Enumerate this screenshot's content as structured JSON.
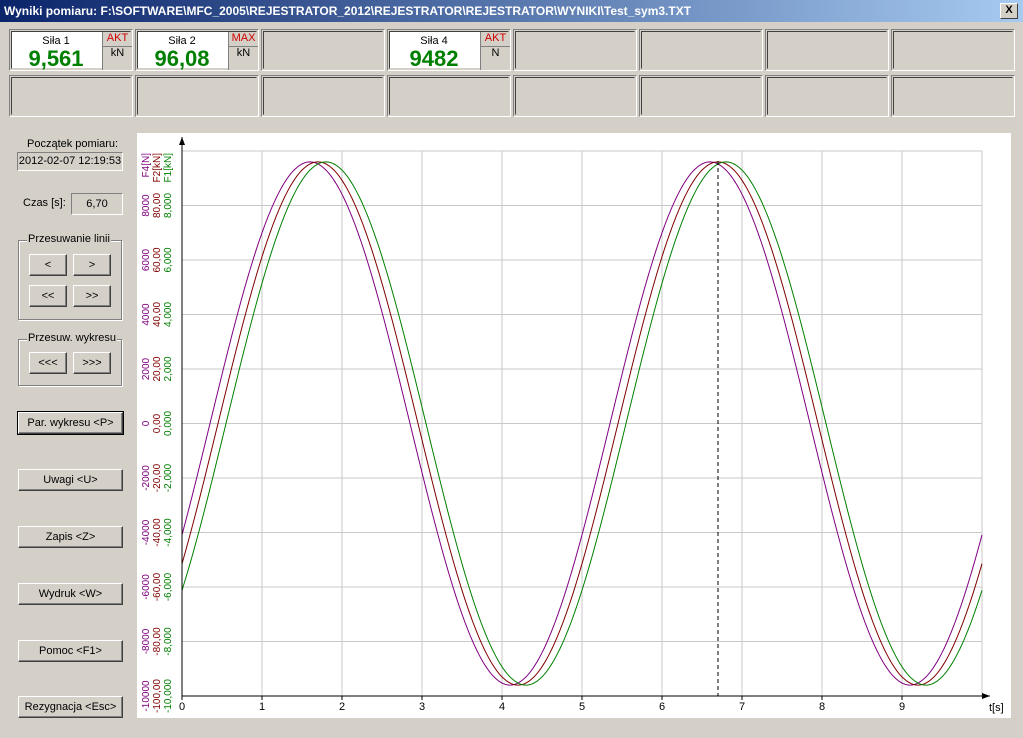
{
  "window": {
    "title": "Wyniki pomiaru: F:\\SOFTWARE\\MFC_2005\\REJESTRATOR_2012\\REJESTRATOR\\REJESTRATOR\\WYNIKI\\Test_sym3.TXT",
    "close": "X"
  },
  "panels": [
    {
      "name": "Siła 1",
      "value": "9,561",
      "mode": "AKT",
      "unit": "kN"
    },
    {
      "name": "Siła 2",
      "value": "96,08",
      "mode": "MAX",
      "unit": "kN"
    },
    {
      "name": "Siła 4",
      "value": "9482",
      "mode": "AKT",
      "unit": "N"
    }
  ],
  "left": {
    "start_label": "Początek pomiaru:",
    "start_value": "2012-02-07 12:19:53",
    "time_label": "Czas [s]:",
    "time_value": "6,70",
    "line_shift": {
      "title": "Przesuwanie linii",
      "b1": "<",
      "b2": ">",
      "b3": "<<",
      "b4": ">>"
    },
    "chart_shift": {
      "title": "Przesuw. wykresu",
      "b1": "<<<",
      "b2": ">>>"
    },
    "buttons": {
      "params": "Par. wykresu <P>",
      "notes": "Uwagi <U>",
      "save": "Zapis <Z>",
      "print": "Wydruk <W>",
      "help": "Pomoc <F1>",
      "cancel": "Rezygnacja <Esc>"
    }
  },
  "colors": {
    "f1": "#008000",
    "f2": "#800000",
    "f4": "#800080",
    "accent": "#0a246a"
  },
  "chart_data": {
    "type": "line",
    "xlabel": "t[s]",
    "xlim": [
      0,
      10.1
    ],
    "xticks": [
      "0",
      "1",
      "2",
      "3",
      "4",
      "5",
      "6",
      "7",
      "8",
      "9"
    ],
    "cursor_x": 6.7,
    "grid": true,
    "axes": [
      {
        "label": "F4[N]",
        "color": "#800080",
        "ylim": [
          -10000,
          10000
        ],
        "ticks": [
          "-10000",
          "-8000",
          "-6000",
          "-4000",
          "-2000",
          "0",
          "2000",
          "4000",
          "6000",
          "8000"
        ]
      },
      {
        "label": "F2[kN]",
        "color": "#800000",
        "ylim": [
          -100,
          100
        ],
        "ticks": [
          "-100,00",
          "-80,00",
          "-60,00",
          "-40,00",
          "-20,00",
          "0,00",
          "20,00",
          "40,00",
          "60,00",
          "80,00"
        ]
      },
      {
        "label": "F1[kN]",
        "color": "#008000",
        "ylim": [
          -10,
          10
        ],
        "ticks": [
          "-10,000",
          "-8,000",
          "-6,000",
          "-4,000",
          "-2,000",
          "0,000",
          "2,000",
          "4,000",
          "6,000",
          "8,000"
        ]
      }
    ],
    "series": [
      {
        "name": "F4[N]",
        "color": "#800080",
        "amplitude": 9600,
        "period": 5,
        "peak_t": 1.6
      },
      {
        "name": "F2[kN]",
        "color": "#800000",
        "amplitude": 96,
        "period": 5,
        "peak_t": 1.7
      },
      {
        "name": "F1[kN]",
        "color": "#008000",
        "amplitude": 9.6,
        "period": 5,
        "peak_t": 1.8
      }
    ]
  }
}
